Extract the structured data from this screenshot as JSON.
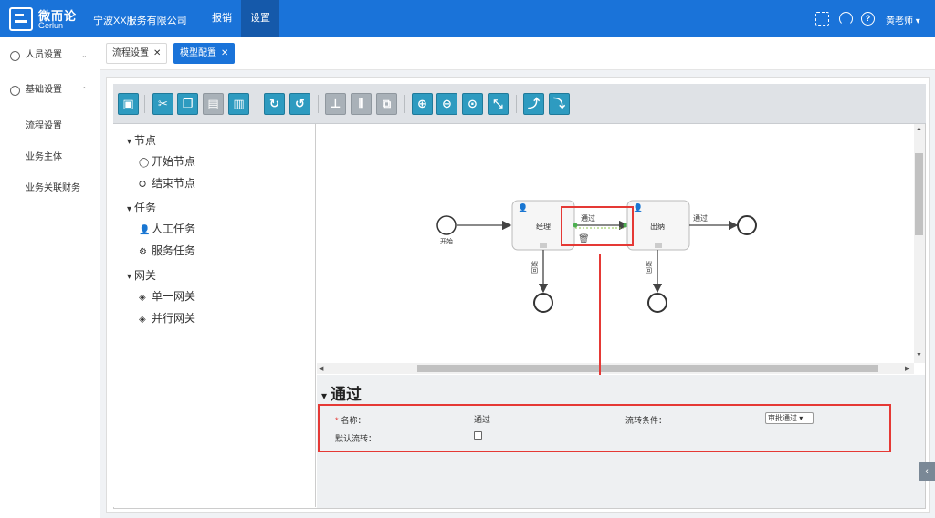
{
  "header": {
    "logo_cn": "微而论",
    "logo_en": "Gerlun",
    "company": "宁波XX服务有限公司",
    "nav": [
      "报销",
      "设置"
    ],
    "active_nav": "设置",
    "user": "黄老师 ▾"
  },
  "sidebar": {
    "groups": [
      {
        "label": "人员设置",
        "chevron": "⌄"
      },
      {
        "label": "基础设置",
        "chevron": "⌃"
      }
    ],
    "items": [
      "流程设置",
      "业务主体",
      "业务关联财务"
    ]
  },
  "tabs": [
    {
      "label": "流程设置",
      "active": false
    },
    {
      "label": "模型配置",
      "active": true
    }
  ],
  "toolbar": {
    "buttons": [
      "save-icon",
      "cut-icon",
      "copy-icon",
      "paste-icon",
      "delete-icon",
      "redo-icon",
      "undo-icon",
      "align-top-icon",
      "align-center-icon",
      "arrange-icon",
      "zoom-in-icon",
      "zoom-out-icon",
      "zoom-actual-icon",
      "fit-icon",
      "add-path-icon",
      "edit-path-icon"
    ]
  },
  "palette": {
    "groups": [
      {
        "label": "节点",
        "items": [
          {
            "icon": "circle-outline-icon",
            "glyph": "◯",
            "label": "开始节点"
          },
          {
            "icon": "circle-bold-icon",
            "glyph": "⭘",
            "label": "结束节点"
          }
        ]
      },
      {
        "label": "任务",
        "items": [
          {
            "icon": "user-icon",
            "glyph": "👤",
            "label": "人工任务"
          },
          {
            "icon": "gear-icon",
            "glyph": "⚙",
            "label": "服务任务"
          }
        ]
      },
      {
        "label": "网关",
        "items": [
          {
            "icon": "exclusive-gateway-icon",
            "glyph": "◈",
            "label": "单一网关"
          },
          {
            "icon": "parallel-gateway-icon",
            "glyph": "◈",
            "label": "并行网关"
          }
        ]
      }
    ]
  },
  "diagram": {
    "start_label": "开始",
    "task1_label": "经理",
    "task2_label": "出纳",
    "edge_pass_label": "通过",
    "edge_pass2_label": "通过",
    "edge_reject1_label": "驳回",
    "edge_reject2_label": "驳回"
  },
  "properties": {
    "title": "通过",
    "name_label": "名称：",
    "name_value": "通过",
    "condition_label": "流转条件：",
    "condition_value": "审批通过 ▾",
    "default_label": "默认流转：",
    "default_checked": false
  },
  "colors": {
    "primary": "#1a73d9",
    "toolbar_button": "#2e9bc0",
    "highlight": "#e53935"
  }
}
